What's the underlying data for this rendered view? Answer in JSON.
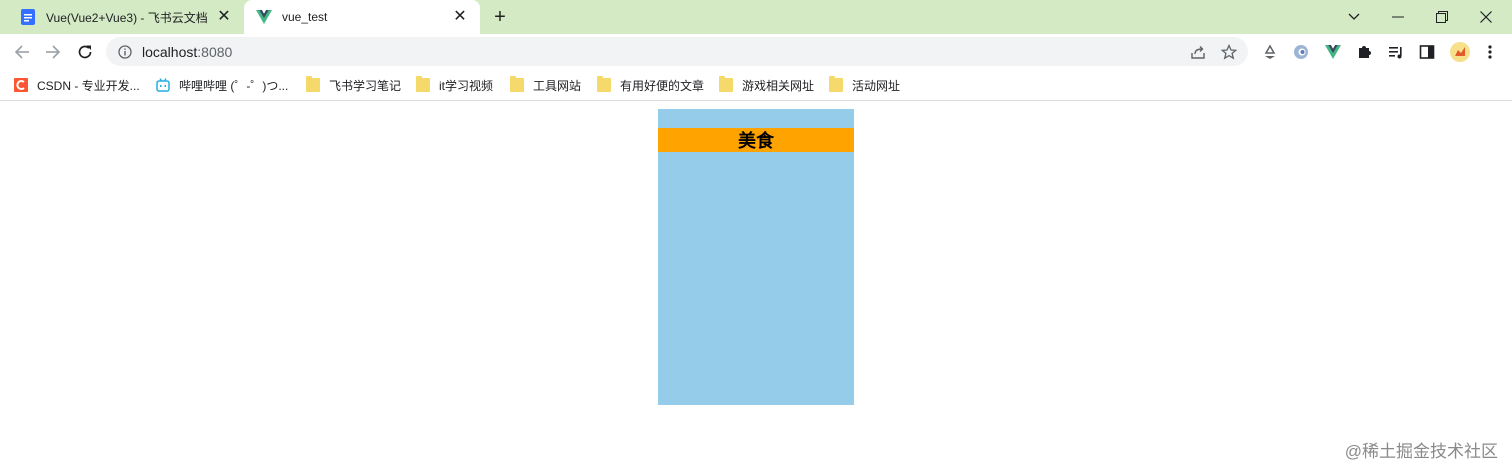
{
  "tabs": [
    {
      "title": "Vue(Vue2+Vue3) - 飞书云文档",
      "active": false,
      "icon": "doc-icon"
    },
    {
      "title": "vue_test",
      "active": true,
      "icon": "vue-icon"
    }
  ],
  "tab_close_glyph": "✕",
  "new_tab_glyph": "+",
  "window_controls": {
    "dropdown": "⌵",
    "minimize": "—",
    "restore": "❐",
    "close": "✕"
  },
  "address_bar": {
    "host": "localhost",
    "port": ":8080"
  },
  "bookmarks": [
    {
      "label": "CSDN - 专业开发...",
      "icon": "csdn-icon"
    },
    {
      "label": "哔哩哔哩 (゜-゜)つ...",
      "icon": "bilibili-icon"
    },
    {
      "label": "飞书学习笔记",
      "icon": "folder-icon"
    },
    {
      "label": "it学习视频",
      "icon": "folder-icon"
    },
    {
      "label": "工具网站",
      "icon": "folder-icon"
    },
    {
      "label": "有用好便的文章",
      "icon": "folder-icon"
    },
    {
      "label": "游戏相关网址",
      "icon": "folder-icon"
    },
    {
      "label": "活动网址",
      "icon": "folder-icon"
    }
  ],
  "page": {
    "header_title": "美食",
    "background_color": "#94cce9",
    "header_color": "#ffa300"
  },
  "watermark": "@稀土掘金技术社区"
}
